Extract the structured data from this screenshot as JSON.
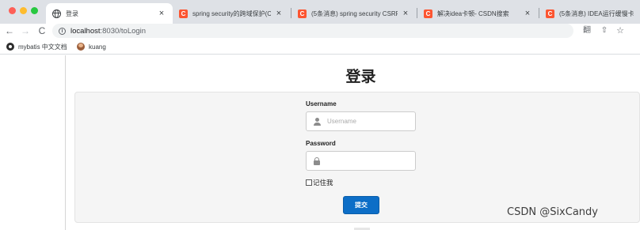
{
  "browser": {
    "tabs": [
      {
        "title": "登录",
        "icon": "globe-icon",
        "active": true
      },
      {
        "title": "spring security的跨域保护(CSRF",
        "icon": "csdn-icon"
      },
      {
        "title": "(5条消息) spring security CSRF",
        "icon": "csdn-icon"
      },
      {
        "title": "解决idea卡顿- CSDN搜索",
        "icon": "csdn-icon"
      },
      {
        "title": "(5条消息) IDEA运行缓慢卡",
        "icon": "csdn-icon"
      }
    ],
    "tab_close": "×",
    "favicon_letter": "C",
    "nav": {
      "back": "←",
      "forward": "→",
      "reload": "C"
    },
    "url": {
      "host": "localhost",
      "path": ":8030/toLogin"
    },
    "toolbar_icons": {
      "translate": "翻",
      "share": "⇧",
      "star": "☆"
    },
    "bookmarks": [
      {
        "label": "mybatis 中文文档"
      },
      {
        "label": "kuang"
      }
    ]
  },
  "page": {
    "heading": "登录",
    "username_label": "Username",
    "username_placeholder": "Username",
    "password_label": "Password",
    "remember_label": "记住我",
    "submit_label": "提交"
  },
  "watermark": "CSDN @SixCandy",
  "colors": {
    "primary_button": "#0d6ec7",
    "csdn_brand": "#fc5531"
  }
}
